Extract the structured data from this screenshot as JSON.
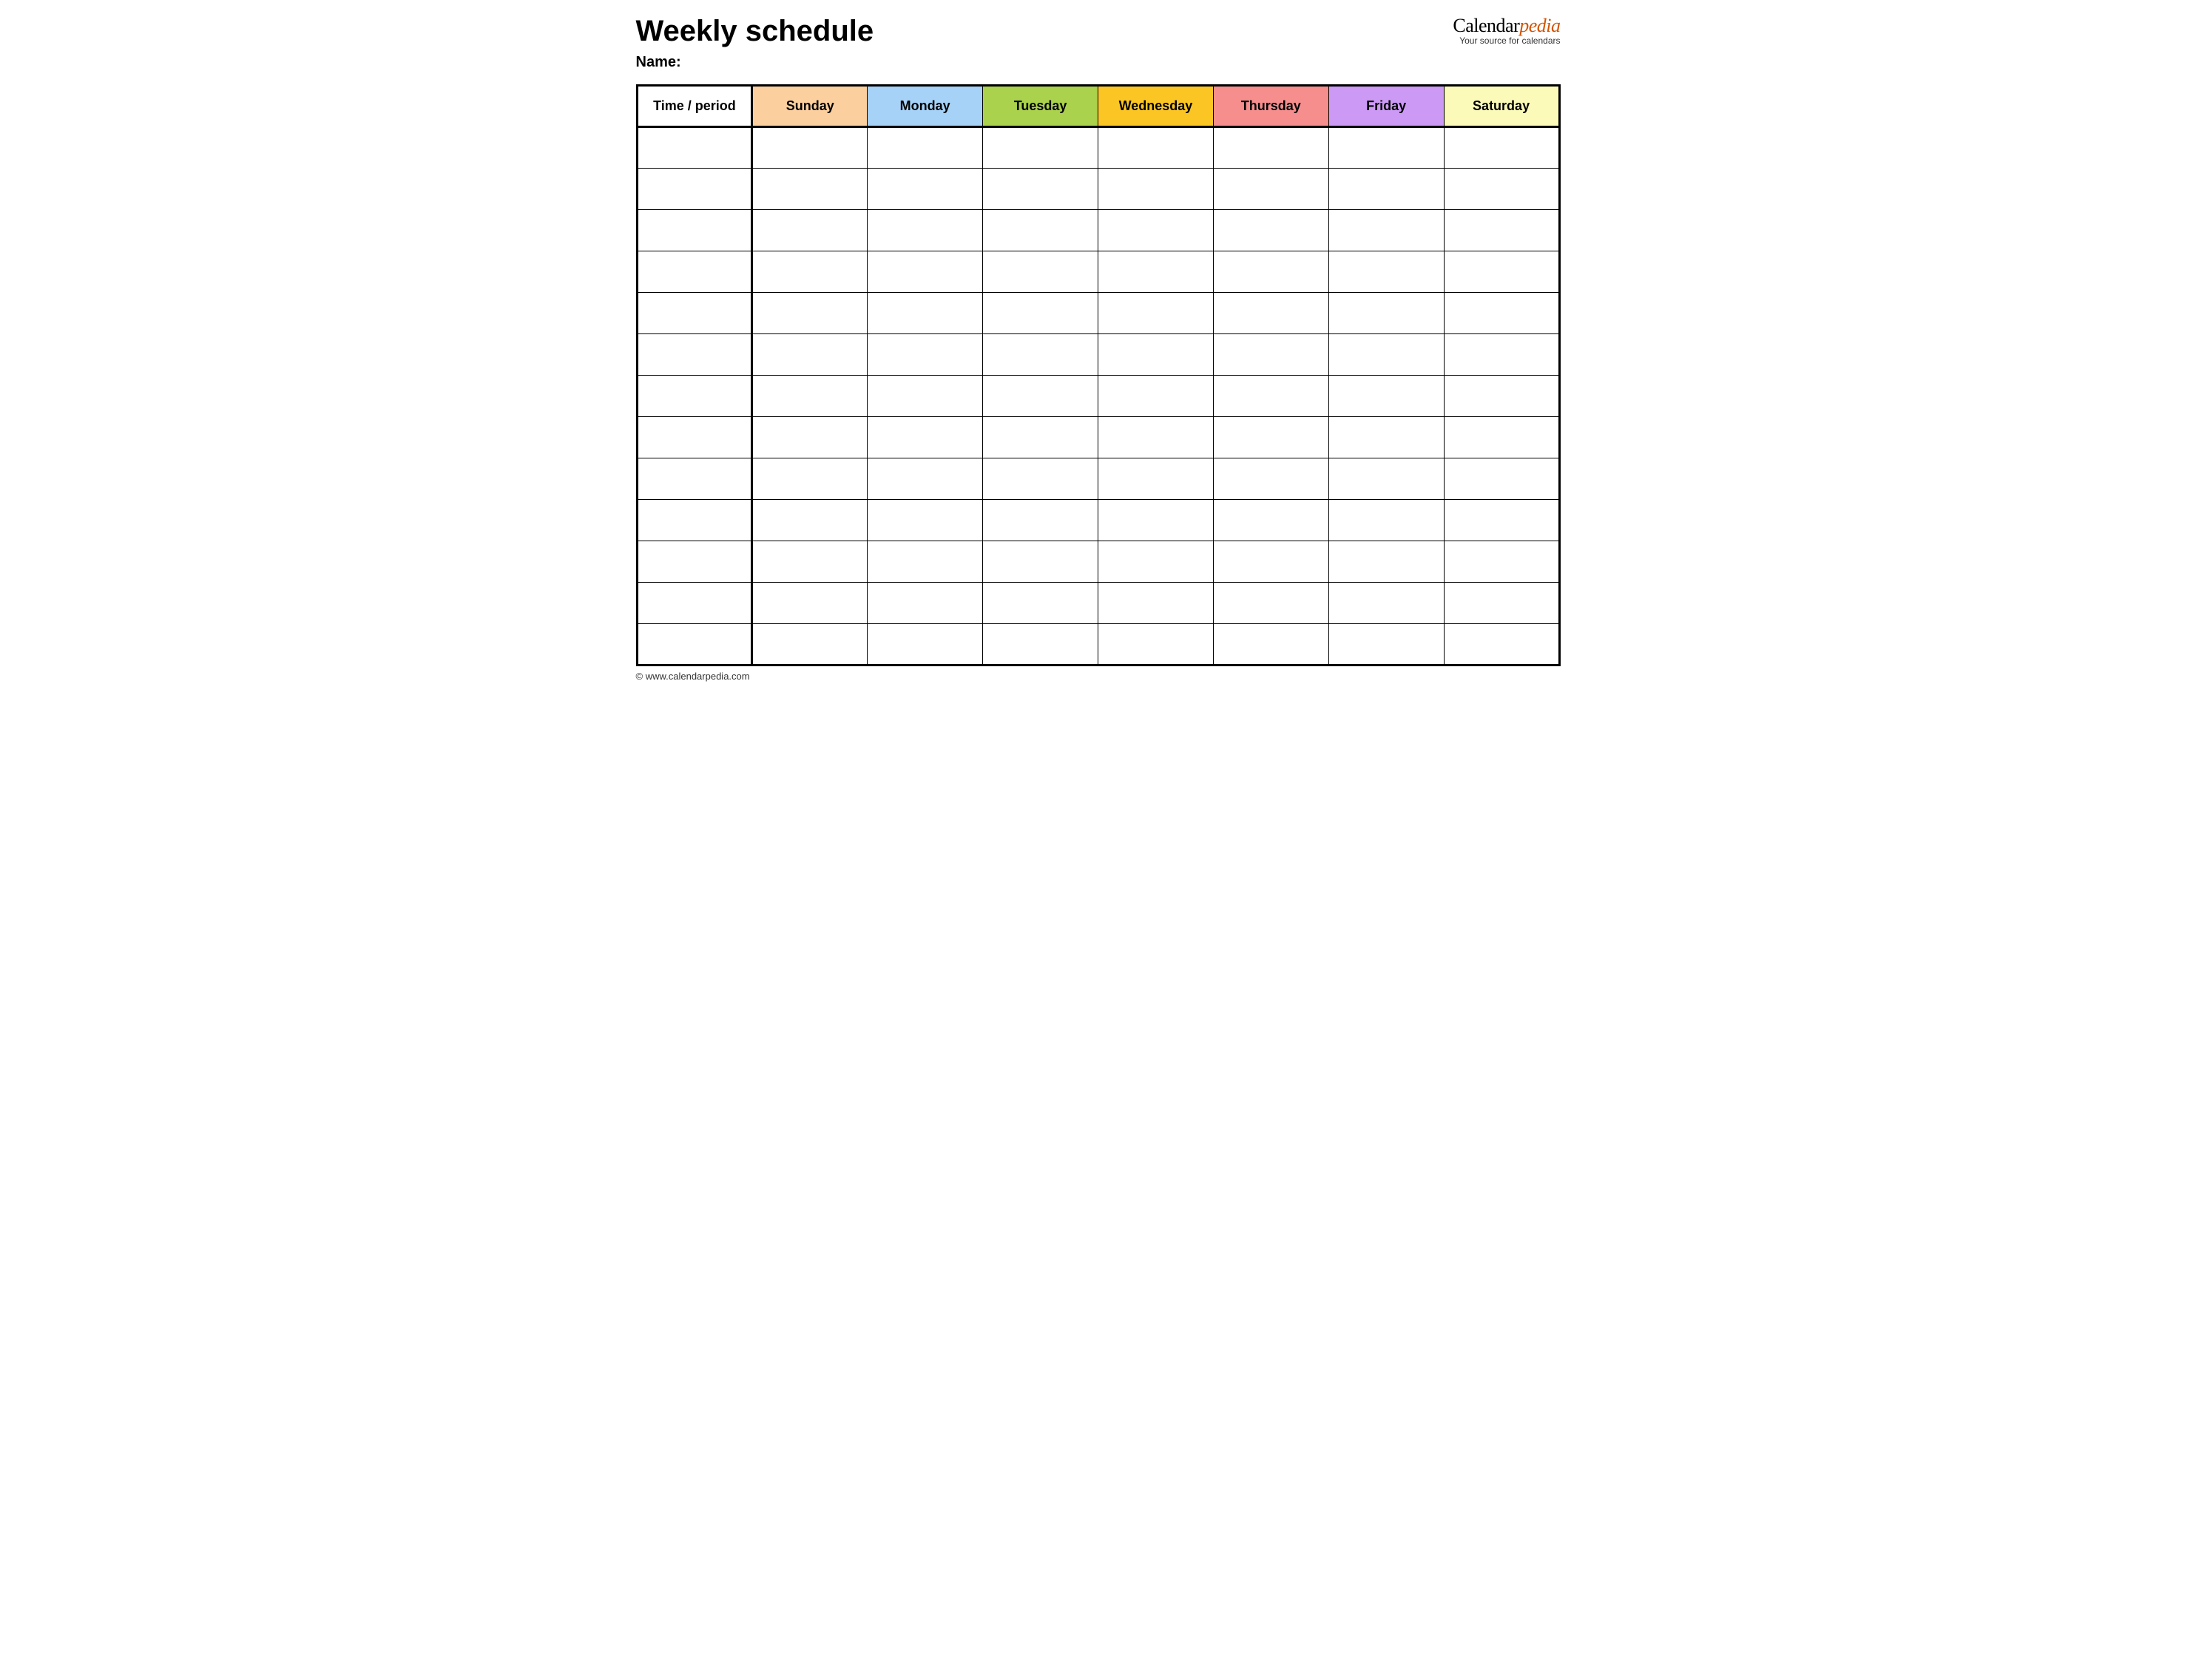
{
  "header": {
    "title": "Weekly schedule",
    "name_label": "Name:",
    "brand_prefix": "Calendar",
    "brand_suffix": "pedia",
    "brand_tagline": "Your source for calendars"
  },
  "table": {
    "time_header": "Time / period",
    "days": [
      {
        "label": "Sunday",
        "color": "#fccf9f"
      },
      {
        "label": "Monday",
        "color": "#a6d2f8"
      },
      {
        "label": "Tuesday",
        "color": "#aad24d"
      },
      {
        "label": "Wednesday",
        "color": "#fbc624"
      },
      {
        "label": "Thursday",
        "color": "#f68e8e"
      },
      {
        "label": "Friday",
        "color": "#cc9af5"
      },
      {
        "label": "Saturday",
        "color": "#fbfab9"
      }
    ],
    "row_count": 13
  },
  "footer": {
    "copyright": "© www.calendarpedia.com"
  }
}
